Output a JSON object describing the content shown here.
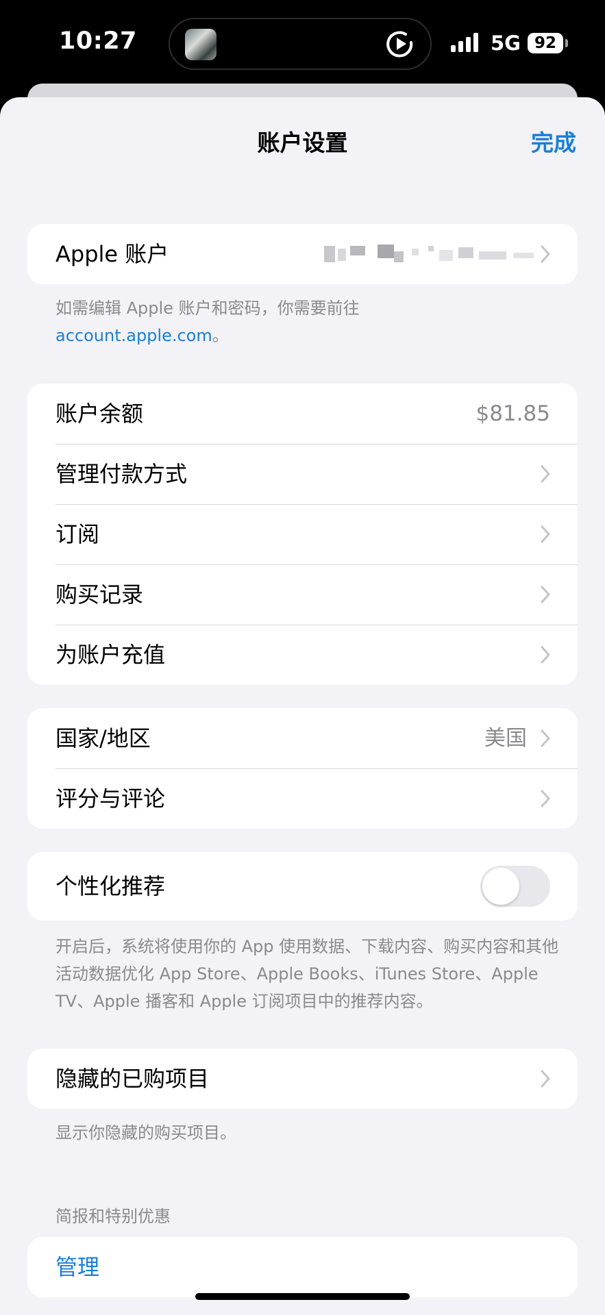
{
  "status_bar": {
    "time": "10:27",
    "network": "5G",
    "battery": "92",
    "icons": [
      "album-art-icon",
      "play-icon",
      "signal-icon",
      "battery-icon"
    ]
  },
  "nav": {
    "title": "账户设置",
    "done_label": "完成"
  },
  "account": {
    "label": "Apple 账户",
    "note_prefix": "如需编辑 Apple 账户和密码，你需要前往",
    "note_link": "account.apple.com",
    "note_suffix": "。"
  },
  "billing": {
    "rows": [
      {
        "label": "账户余额",
        "value": "$81.85"
      },
      {
        "label": "管理付款方式"
      },
      {
        "label": "订阅"
      },
      {
        "label": "购买记录"
      },
      {
        "label": "为账户充值"
      }
    ]
  },
  "region": {
    "rows": [
      {
        "label": "国家/地区",
        "value": "美国"
      },
      {
        "label": "评分与评论"
      }
    ]
  },
  "personalization": {
    "label": "个性化推荐",
    "toggle_on": false,
    "note": "开启后，系统将使用你的 App 使用数据、下载内容、购买内容和其他活动数据优化 App Store、Apple Books、iTunes Store、Apple TV、Apple 播客和 Apple 订阅项目中的推荐内容。"
  },
  "hidden": {
    "label": "隐藏的已购项目",
    "note": "显示你隐藏的购买项目。"
  },
  "newsletter": {
    "header": "简报和特别优惠",
    "manage_label": "管理"
  },
  "colors": {
    "accent": "#1a7fd6",
    "background": "#f2f2f7",
    "card": "#ffffff",
    "secondary_text": "#8a8a8e"
  }
}
